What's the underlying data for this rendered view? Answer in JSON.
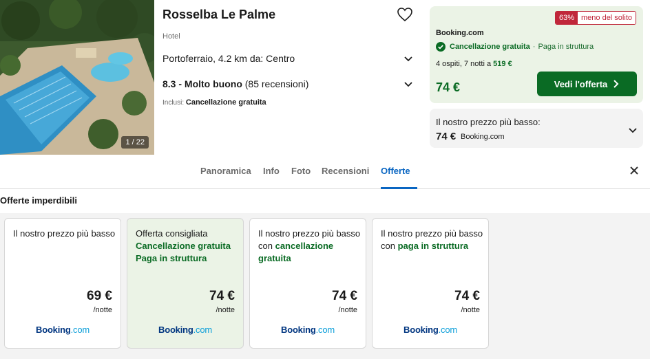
{
  "hotel": {
    "name": "Rosselba Le Palme",
    "type": "Hotel",
    "location": "Portoferraio, 4.2 km da: Centro",
    "rating_score": "8.3 - Molto buono",
    "rating_reviews": "(85 recensioni)",
    "included_label": "Inclusi:",
    "included_value": "Cancellazione gratuita",
    "photo_counter": "1 / 22"
  },
  "deal": {
    "badge_percent": "63%",
    "badge_text": "meno del solito",
    "provider": "Booking.com",
    "cancellation": "Cancellazione gratuita",
    "separator": "·",
    "payment": "Paga in struttura",
    "guests_text": "4 ospiti, 7 notti a",
    "total": "519 €",
    "price": "74 €",
    "button_label": "Vedi l'offerta"
  },
  "lowest": {
    "title": "Il nostro prezzo più basso:",
    "price": "74 €",
    "provider": "Booking.com"
  },
  "tabs": [
    {
      "label": "Panoramica"
    },
    {
      "label": "Info"
    },
    {
      "label": "Foto"
    },
    {
      "label": "Recensioni"
    },
    {
      "label": "Offerte"
    }
  ],
  "offers": {
    "title": "Offerte imperdibili",
    "cards": [
      {
        "line1": "Il nostro prezzo più basso",
        "price": "69 €",
        "unit": "/notte",
        "logo_main": "Booking",
        "logo_suffix": ".com"
      },
      {
        "line1": "Offerta consigliata",
        "green1": "Cancellazione gratuita",
        "green2": "Paga in struttura",
        "price": "74 €",
        "unit": "/notte",
        "logo_main": "Booking",
        "logo_suffix": ".com"
      },
      {
        "line1": "Il nostro prezzo più basso con",
        "green1": "cancellazione gratuita",
        "price": "74 €",
        "unit": "/notte",
        "logo_main": "Booking",
        "logo_suffix": ".com"
      },
      {
        "line1": "Il nostro prezzo più basso con",
        "green1": "paga in struttura",
        "price": "74 €",
        "unit": "/notte",
        "logo_main": "Booking",
        "logo_suffix": ".com"
      }
    ]
  },
  "colors": {
    "accent_blue": "#0a66c2",
    "deal_green": "#0a6b24",
    "badge_red": "#c0263a",
    "booking_navy": "#003580",
    "booking_cyan": "#0a9ed9"
  },
  "icons": [
    "heart-icon",
    "chevron-down-icon",
    "check-circle-icon",
    "chevron-right-icon",
    "close-icon"
  ]
}
